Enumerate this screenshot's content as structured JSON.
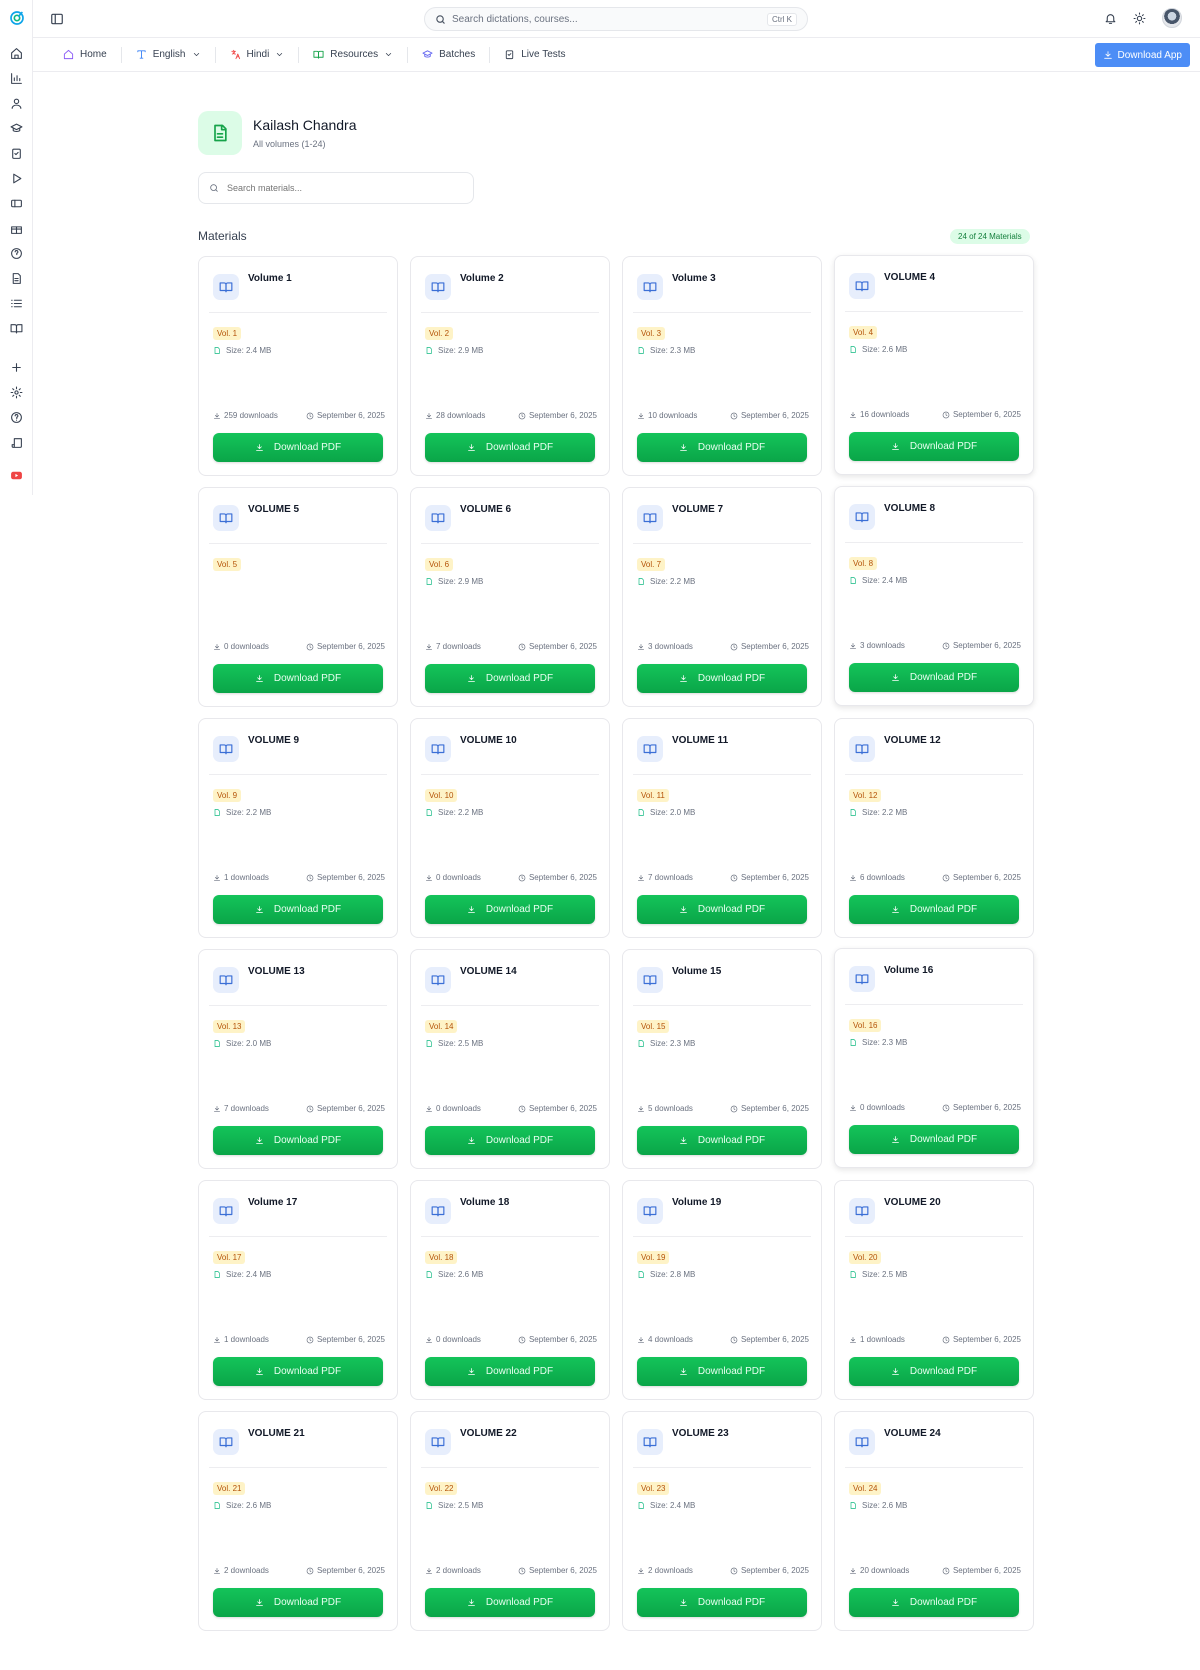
{
  "topbar": {
    "search_placeholder": "Search dictations, courses...",
    "shortcut": "Ctrl K"
  },
  "nav": {
    "items": [
      {
        "label": "Home",
        "icon": "home-icon",
        "dropdown": false
      },
      {
        "label": "English",
        "icon": "type-icon",
        "dropdown": true
      },
      {
        "label": "Hindi",
        "icon": "translate-icon",
        "dropdown": true
      },
      {
        "label": "Resources",
        "icon": "book-open-icon",
        "dropdown": true
      },
      {
        "label": "Batches",
        "icon": "graduation-cap-icon",
        "dropdown": false
      },
      {
        "label": "Live Tests",
        "icon": "clipboard-icon",
        "dropdown": false
      }
    ],
    "download_app": "Download App"
  },
  "header": {
    "name": "Kailash Chandra",
    "subtitle": "All volumes (1-24)",
    "search_placeholder": "Search materials..."
  },
  "materials": {
    "title": "Materials",
    "count_badge": "24 of 24 Materials",
    "button_label": "Download PDF",
    "items": [
      {
        "title": "Volume 1",
        "vol": "Vol. 1",
        "size": "Size: 2.4 MB",
        "downloads": "259 downloads",
        "date": "September 6, 2025",
        "elevated": false
      },
      {
        "title": "Volume 2",
        "vol": "Vol. 2",
        "size": "Size: 2.9 MB",
        "downloads": "28 downloads",
        "date": "September 6, 2025",
        "elevated": false
      },
      {
        "title": "Volume 3",
        "vol": "Vol. 3",
        "size": "Size: 2.3 MB",
        "downloads": "10 downloads",
        "date": "September 6, 2025",
        "elevated": false
      },
      {
        "title": "VOLUME 4",
        "vol": "Vol. 4",
        "size": "Size: 2.6 MB",
        "downloads": "16 downloads",
        "date": "September 6, 2025",
        "elevated": true
      },
      {
        "title": "VOLUME 5",
        "vol": "Vol. 5",
        "size": "",
        "downloads": "0 downloads",
        "date": "September 6, 2025",
        "elevated": false
      },
      {
        "title": "VOLUME 6",
        "vol": "Vol. 6",
        "size": "Size: 2.9 MB",
        "downloads": "7 downloads",
        "date": "September 6, 2025",
        "elevated": false
      },
      {
        "title": "VOLUME 7",
        "vol": "Vol. 7",
        "size": "Size: 2.2 MB",
        "downloads": "3 downloads",
        "date": "September 6, 2025",
        "elevated": false
      },
      {
        "title": "VOLUME 8",
        "vol": "Vol. 8",
        "size": "Size: 2.4 MB",
        "downloads": "3 downloads",
        "date": "September 6, 2025",
        "elevated": true
      },
      {
        "title": "VOLUME 9",
        "vol": "Vol. 9",
        "size": "Size: 2.2 MB",
        "downloads": "1 downloads",
        "date": "September 6, 2025",
        "elevated": false
      },
      {
        "title": "VOLUME 10",
        "vol": "Vol. 10",
        "size": "Size: 2.2 MB",
        "downloads": "0 downloads",
        "date": "September 6, 2025",
        "elevated": false
      },
      {
        "title": "VOLUME 11",
        "vol": "Vol. 11",
        "size": "Size: 2.0 MB",
        "downloads": "7 downloads",
        "date": "September 6, 2025",
        "elevated": false
      },
      {
        "title": "VOLUME 12",
        "vol": "Vol. 12",
        "size": "Size: 2.2 MB",
        "downloads": "6 downloads",
        "date": "September 6, 2025",
        "elevated": false
      },
      {
        "title": "VOLUME 13",
        "vol": "Vol. 13",
        "size": "Size: 2.0 MB",
        "downloads": "7 downloads",
        "date": "September 6, 2025",
        "elevated": false
      },
      {
        "title": "VOLUME 14",
        "vol": "Vol. 14",
        "size": "Size: 2.5 MB",
        "downloads": "0 downloads",
        "date": "September 6, 2025",
        "elevated": false
      },
      {
        "title": "Volume 15",
        "vol": "Vol. 15",
        "size": "Size: 2.3 MB",
        "downloads": "5 downloads",
        "date": "September 6, 2025",
        "elevated": false
      },
      {
        "title": "Volume 16",
        "vol": "Vol. 16",
        "size": "Size: 2.3 MB",
        "downloads": "0 downloads",
        "date": "September 6, 2025",
        "elevated": true
      },
      {
        "title": "Volume 17",
        "vol": "Vol. 17",
        "size": "Size: 2.4 MB",
        "downloads": "1 downloads",
        "date": "September 6, 2025",
        "elevated": false
      },
      {
        "title": "Volume 18",
        "vol": "Vol. 18",
        "size": "Size: 2.6 MB",
        "downloads": "0 downloads",
        "date": "September 6, 2025",
        "elevated": false
      },
      {
        "title": "Volume 19",
        "vol": "Vol. 19",
        "size": "Size: 2.8 MB",
        "downloads": "4 downloads",
        "date": "September 6, 2025",
        "elevated": false
      },
      {
        "title": "VOLUME 20",
        "vol": "Vol. 20",
        "size": "Size: 2.5 MB",
        "downloads": "1 downloads",
        "date": "September 6, 2025",
        "elevated": false
      },
      {
        "title": "VOLUME 21",
        "vol": "Vol. 21",
        "size": "Size: 2.6 MB",
        "downloads": "2 downloads",
        "date": "September 6, 2025",
        "elevated": false
      },
      {
        "title": "VOLUME 22",
        "vol": "Vol. 22",
        "size": "Size: 2.5 MB",
        "downloads": "2 downloads",
        "date": "September 6, 2025",
        "elevated": false
      },
      {
        "title": "VOLUME 23",
        "vol": "Vol. 23",
        "size": "Size: 2.4 MB",
        "downloads": "2 downloads",
        "date": "September 6, 2025",
        "elevated": false
      },
      {
        "title": "VOLUME 24",
        "vol": "Vol. 24",
        "size": "Size: 2.6 MB",
        "downloads": "20 downloads",
        "date": "September 6, 2025",
        "elevated": false
      }
    ]
  },
  "rail_icons": [
    "home-icon",
    "chart-icon",
    "user-icon",
    "graduation-cap-icon",
    "clipboard-icon",
    "play-icon",
    "ticket-icon",
    "gift-icon",
    "help-icon",
    "file-icon",
    "list-icon",
    "book-open-icon",
    "plus-icon",
    "settings-icon",
    "help-circle-icon",
    "scroll-icon",
    "youtube-icon"
  ],
  "colors": {
    "accent_green": "#0aa548",
    "accent_blue": "#4c8df6",
    "vol_badge_bg": "#fef3c7",
    "vol_badge_text": "#b45309"
  }
}
